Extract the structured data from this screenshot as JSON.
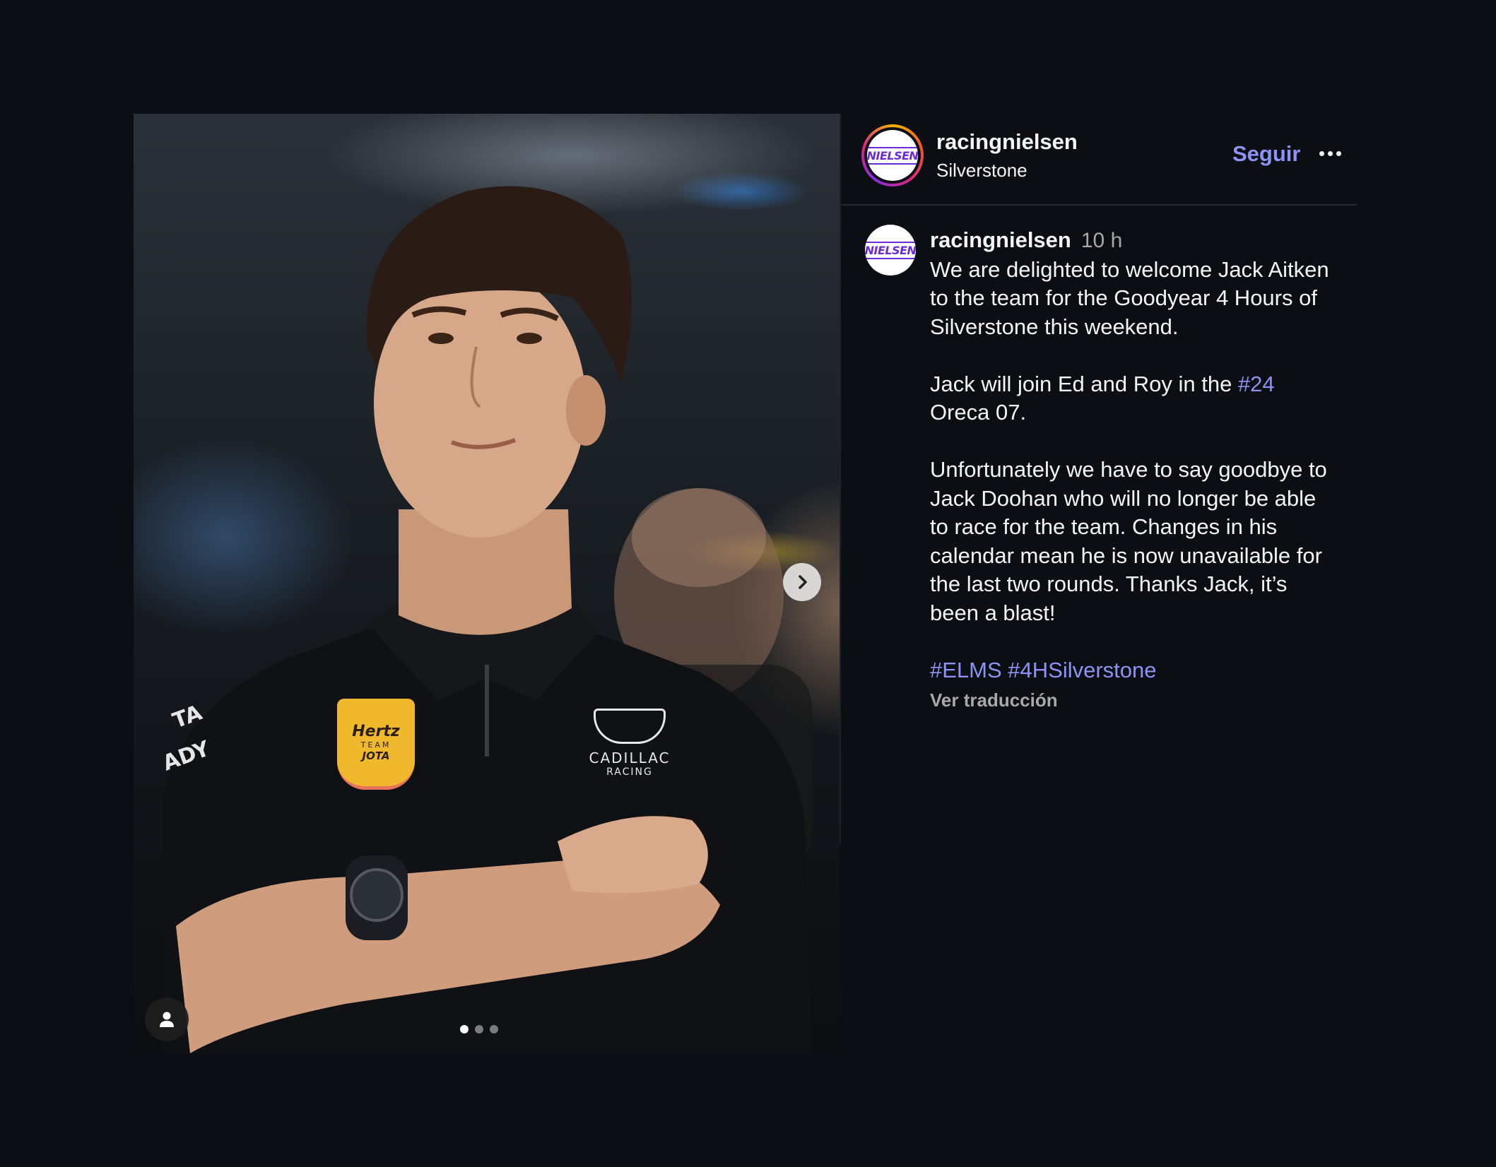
{
  "post": {
    "username": "racingnielsen",
    "location": "Silverstone",
    "follow_label": "Seguir",
    "avatar_logo_text": "NIELSEN",
    "carousel": {
      "total": 3,
      "active_index": 0
    }
  },
  "caption": {
    "username": "racingnielsen",
    "time": "10 h",
    "para1": "We are delighted to welcome Jack Aitken to the team for the Goodyear 4 Hours of Silverstone this weekend.",
    "para2_prefix": "Jack will join Ed and Roy in the ",
    "para2_tag": "#24",
    "para2_suffix": " Oreca 07.",
    "para3": "Unfortunately we have to say goodbye to Jack Doohan who will no longer be able to race for the team. Changes in his calendar mean he is now unavailable for the last two rounds. Thanks Jack, it’s been a blast!",
    "tag1": "#ELMS",
    "tag2": "#4HSilverstone",
    "translate_label": "Ver traducción"
  },
  "photo": {
    "patch_brand": "Hertz",
    "patch_team": "TEAM",
    "patch_name": "JOTA",
    "shirt_logo": "CADILLAC",
    "shirt_sub": "RACING"
  },
  "colors": {
    "background": "#0b0f14",
    "link": "#8c93f4",
    "muted": "#a8a8a8",
    "text": "#f5f5f5"
  },
  "icons": {
    "next": "chevron-right-icon",
    "tags": "person-icon",
    "more": "more-horizontal-icon"
  }
}
